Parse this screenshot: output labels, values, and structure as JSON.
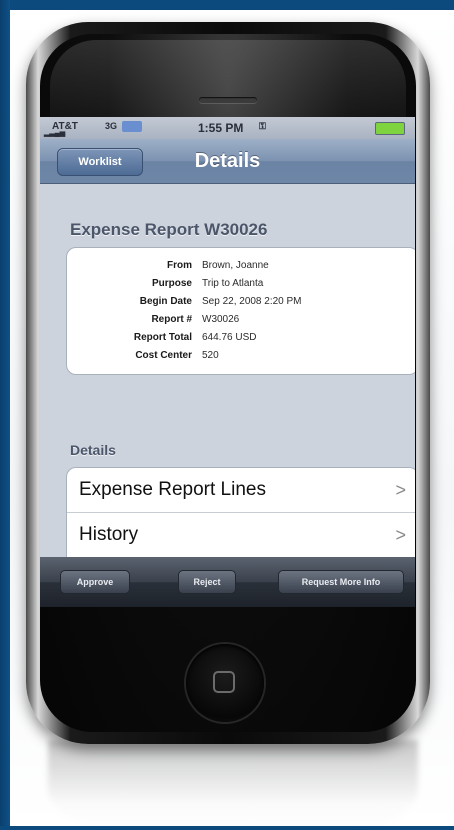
{
  "status_bar": {
    "carrier": "AT&T",
    "network": "3G",
    "time": "1:55 PM",
    "lock": "⚿"
  },
  "nav": {
    "back_label": "Worklist",
    "title": "Details"
  },
  "report": {
    "title": "Expense Report W30026",
    "fields": [
      {
        "label": "From",
        "value": "Brown, Joanne"
      },
      {
        "label": "Purpose",
        "value": "Trip to Atlanta"
      },
      {
        "label": "Begin Date",
        "value": "Sep 22, 2008 2:20 PM"
      },
      {
        "label": "Report #",
        "value": "W30026"
      },
      {
        "label": "Report Total",
        "value": "644.76 USD"
      },
      {
        "label": "Cost Center",
        "value": "520"
      }
    ]
  },
  "details": {
    "header": "Details",
    "rows": [
      {
        "label": "Expense Report Lines",
        "chevron": ">"
      },
      {
        "label": "History",
        "chevron": ">"
      }
    ]
  },
  "toolbar": {
    "approve": "Approve",
    "reject": "Reject",
    "request_more_info": "Request More Info"
  },
  "colors": {
    "navbar": "#7c92b0",
    "screen_bg": "#ccd3dd",
    "section_text": "#4c566a",
    "toolbar": "#2a3039",
    "backdrop": "#0c4a7d"
  }
}
